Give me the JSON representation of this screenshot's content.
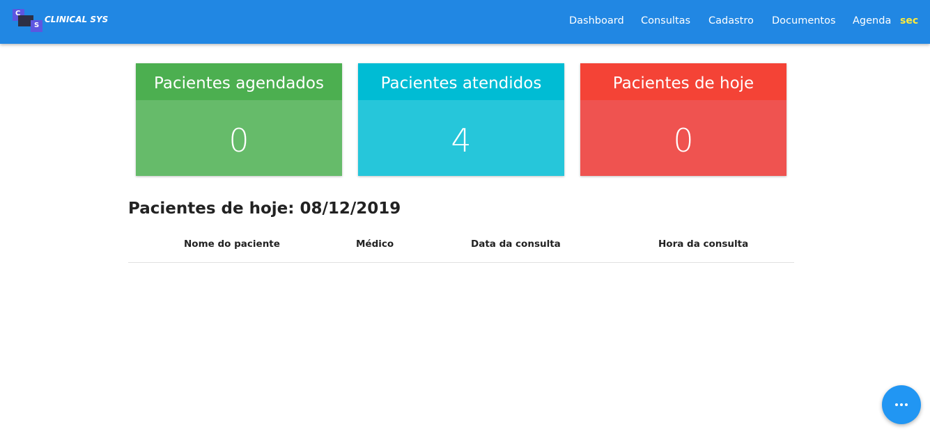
{
  "app": {
    "logo_text": "CLINICAL SYS",
    "logo_letter_top": "C",
    "logo_letter_bottom": "S"
  },
  "nav": {
    "items": [
      "Dashboard",
      "Consultas",
      "Cadastro",
      "Documentos",
      "Agenda"
    ],
    "user": "sec"
  },
  "cards": [
    {
      "title": "Pacientes agendados",
      "value": "0",
      "header_color": "#4caf50",
      "body_color": "#66bb6a"
    },
    {
      "title": "Pacientes atendidos",
      "value": "4",
      "header_color": "#00bcd4",
      "body_color": "#26c6da"
    },
    {
      "title": "Pacientes de hoje",
      "value": "0",
      "header_color": "#f44336",
      "body_color": "#ef5350"
    }
  ],
  "today": {
    "title": "Pacientes de hoje: 08/12/2019",
    "columns": [
      "Nome do paciente",
      "Médico",
      "Data da consulta",
      "Hora da consulta"
    ],
    "rows": []
  },
  "fab": {
    "icon": "more-horizontal-icon"
  }
}
